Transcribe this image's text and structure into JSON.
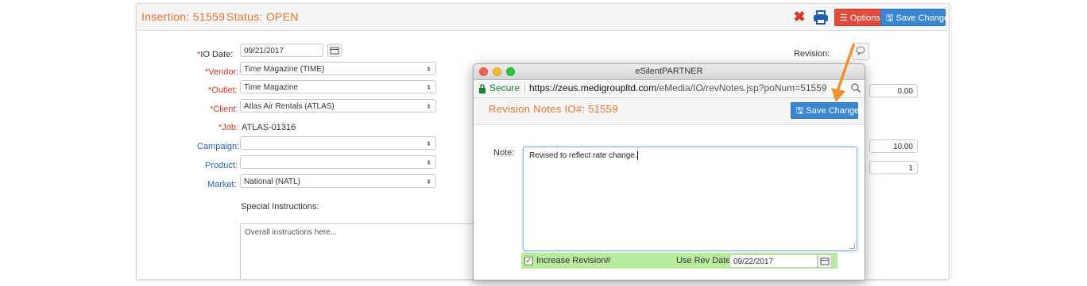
{
  "header": {
    "insertion": "Insertion: 51559",
    "status": "Status: OPEN",
    "options_label": "Options",
    "save_label": "Save Changes"
  },
  "form": {
    "io_date": {
      "label": "IO Date:",
      "value": "09/21/2017"
    },
    "vendor": {
      "label": "Vendor:",
      "value": "Time Magazine (TIME)"
    },
    "outlet": {
      "label": "Outlet:",
      "value": "Time Magazine"
    },
    "client": {
      "label": "Client:",
      "value": "Atlas Air Rentals (ATLAS)"
    },
    "job": {
      "label": "Job:",
      "value": "ATLAS-01316"
    },
    "campaign": {
      "label": "Campaign:",
      "value": ""
    },
    "product": {
      "label": "Product:",
      "value": ""
    },
    "market": {
      "label": "Market:",
      "value": "National (NATL)"
    },
    "special_instructions_label": "Special Instructions:",
    "special_instructions_placeholder": "Overall instructions here...",
    "revision_label": "Revision:",
    "num1": "0.00",
    "num2": "10.00",
    "num3": "1"
  },
  "popup": {
    "window_title": "eSilentPARTNER",
    "secure": "Secure",
    "url_host": "https://zeus.medigroupltd.com",
    "url_path": "/eMedia/IO/revNotes.jsp?poNum=51559",
    "heading": "Revision Notes  IO#: 51559",
    "save_label": "Save Changes",
    "note_label": "Note:",
    "note_value": "Revised to reflect rate change.",
    "increase_label": "Increase Revision#",
    "use_rev_date_label": "Use Rev Date:",
    "use_rev_date_value": "09/22/2017"
  },
  "colors": {
    "accent_orange": "#e8722c",
    "options_red": "#e04b3c",
    "save_blue": "#3a86d3",
    "highlight_green": "#b8ec9c"
  }
}
